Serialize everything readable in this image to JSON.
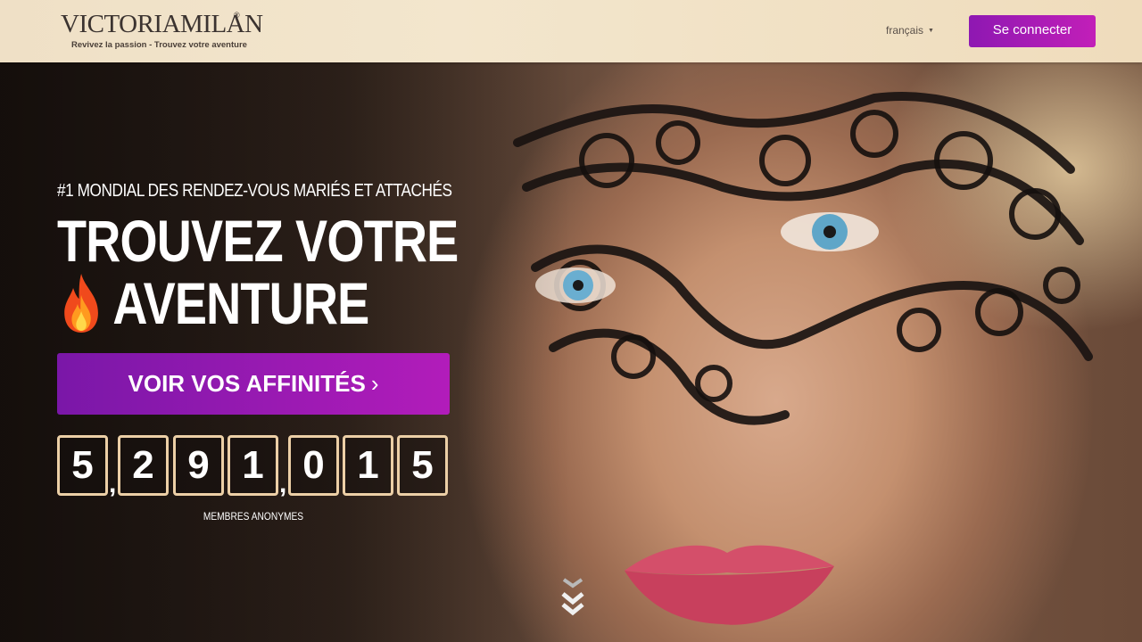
{
  "header": {
    "logo_text": "VICTORIAMILAN",
    "logo_tagline": "Revivez la passion - Trouvez votre aventure",
    "language": "français",
    "login_label": "Se connecter"
  },
  "hero": {
    "kicker": "#1 MONDIAL DES RENDEZ-VOUS MARIÉS ET ATTACHÉS",
    "headline_line1": "TROUVEZ VOTRE",
    "headline_line2": "AVENTURE",
    "cta_label": "VOIR VOS AFFINITÉS",
    "counter": {
      "digits": [
        "5",
        "2",
        "9",
        "1",
        "0",
        "1",
        "5"
      ],
      "separator": ",",
      "label": "MEMBRES ANONYMES"
    }
  },
  "colors": {
    "accent_purple": "#8e18b2",
    "accent_magenta": "#c21fb8",
    "counter_border": "#eccfa6"
  },
  "icons": {
    "flame": "fire-emoji-icon",
    "cta_arrow": "chevron-right-icon",
    "scroll": "double-chevron-down-icon",
    "lang_caret": "caret-down-icon"
  }
}
